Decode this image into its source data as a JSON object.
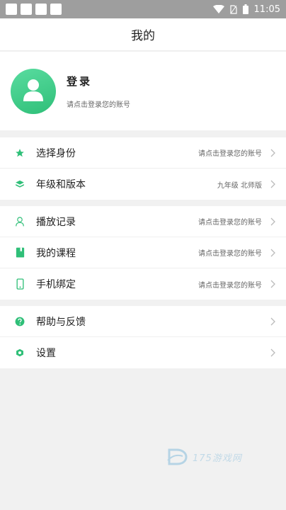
{
  "status_bar": {
    "time": "11:05"
  },
  "header": {
    "title": "我的"
  },
  "profile": {
    "login_label": "登录",
    "hint": "请点击登录您的账号"
  },
  "groups": [
    [
      {
        "label": "选择身份",
        "value": "请点击登录您的账号",
        "icon": "star-icon"
      },
      {
        "label": "年级和版本",
        "value": "九年级 北师版",
        "icon": "layers-icon"
      }
    ],
    [
      {
        "label": "播放记录",
        "value": "请点击登录您的账号",
        "icon": "person-icon"
      },
      {
        "label": "我的课程",
        "value": "请点击登录您的账号",
        "icon": "book-icon"
      },
      {
        "label": "手机绑定",
        "value": "请点击登录您的账号",
        "icon": "phone-icon"
      }
    ],
    [
      {
        "label": "帮助与反馈",
        "value": "",
        "icon": "help-icon"
      },
      {
        "label": "设置",
        "value": "",
        "icon": "settings-icon"
      }
    ]
  ],
  "watermark": {
    "text": "175游戏网"
  },
  "colors": {
    "accent": "#2fbf78",
    "status_bar": "#9e9e9e"
  }
}
